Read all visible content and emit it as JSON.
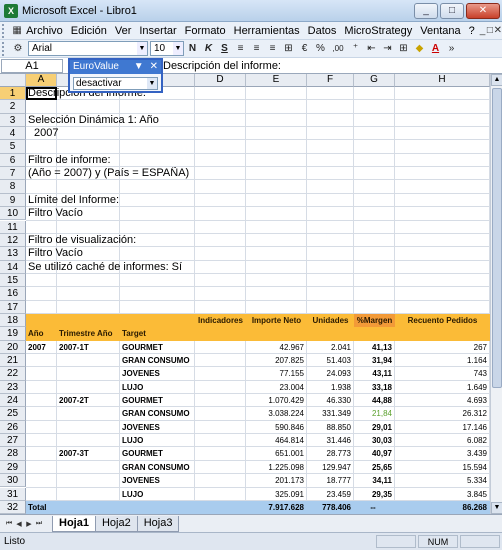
{
  "window": {
    "title": "Microsoft Excel - Libro1",
    "app_icon": "X",
    "min": "_",
    "max": "□",
    "close": "✕"
  },
  "menu": {
    "items": [
      "Archivo",
      "Edición",
      "Ver",
      "Insertar",
      "Formato",
      "Herramientas",
      "Datos",
      "MicroStrategy",
      "Ventana",
      "?"
    ],
    "mdi": [
      "_",
      "□",
      "✕"
    ]
  },
  "toolbar": {
    "font": "Arial",
    "size": "10",
    "bold": "N",
    "italic": "K",
    "underline": "S",
    "percent": "%",
    "comma": "000",
    "thousands": ",00"
  },
  "formula": {
    "cell": "A1",
    "fx": "fx",
    "value": "Descripción del informe:"
  },
  "popup": {
    "title": "EuroValue",
    "selected": "desactivar"
  },
  "columns": [
    "A",
    "B",
    "C",
    "D",
    "E",
    "F",
    "G",
    "H"
  ],
  "rows": [
    "1",
    "2",
    "3",
    "4",
    "5",
    "6",
    "7",
    "8",
    "9",
    "10",
    "11",
    "12",
    "13",
    "14",
    "15",
    "16",
    "17",
    "18",
    "19",
    "20",
    "21",
    "22",
    "23",
    "24",
    "25",
    "26",
    "27",
    "28",
    "29",
    "30",
    "31",
    "32"
  ],
  "info": {
    "r1": "Descripción del informe:",
    "r3": "Selección Dinámica 1: Año",
    "r4": "2007",
    "r6": "Filtro de informe:",
    "r7": "(Año = 2007) y (País = ESPAÑA)",
    "r9": "Límite del Informe:",
    "r10": "Filtro Vacío",
    "r12": "Filtro de visualización:",
    "r13": "Filtro Vacío",
    "r14": "Se utilizó caché de informes: Sí"
  },
  "report": {
    "hdr1": {
      "d": "Indicadores",
      "e": "Importe Neto",
      "f": "Unidades",
      "g": "%Margen",
      "h": "Recuento Pedidos"
    },
    "hdr2": {
      "a": "Año",
      "b": "Trimestre Año",
      "c": "Target"
    },
    "year": "2007",
    "quarters": [
      "2007-1T",
      "2007-2T",
      "2007-3T"
    ],
    "rows": [
      [
        "GOURMET",
        "42.967",
        "2.041",
        "41,13",
        "267"
      ],
      [
        "GRAN CONSUMO",
        "207.825",
        "51.403",
        "31,94",
        "1.164"
      ],
      [
        "JOVENES",
        "77.155",
        "24.093",
        "43,11",
        "743"
      ],
      [
        "LUJO",
        "23.004",
        "1.938",
        "33,18",
        "1.649"
      ],
      [
        "GOURMET",
        "1.070.429",
        "46.330",
        "44,88",
        "4.693"
      ],
      [
        "GRAN CONSUMO",
        "3.038.224",
        "331.349",
        "21,84",
        "26.312"
      ],
      [
        "JOVENES",
        "590.846",
        "88.850",
        "29,01",
        "17.146"
      ],
      [
        "LUJO",
        "464.814",
        "31.446",
        "30,03",
        "6.082"
      ],
      [
        "GOURMET",
        "651.001",
        "28.773",
        "40,97",
        "3.439"
      ],
      [
        "GRAN CONSUMO",
        "1.225.098",
        "129.947",
        "25,65",
        "15.594"
      ],
      [
        "JOVENES",
        "201.173",
        "18.777",
        "34,11",
        "5.334"
      ],
      [
        "LUJO",
        "325.091",
        "23.459",
        "29,35",
        "3.845"
      ]
    ],
    "total": {
      "label": "Total",
      "e": "7.917.628",
      "f": "778.406",
      "g": "--",
      "h": "86.268"
    },
    "colors": {
      "header": "#fbbb37",
      "total": "#a9ccee",
      "margin_highlight": "#5aa02c"
    }
  },
  "sheets": [
    "Hoja1",
    "Hoja2",
    "Hoja3"
  ],
  "status": {
    "text": "Listo",
    "num": "NUM"
  }
}
